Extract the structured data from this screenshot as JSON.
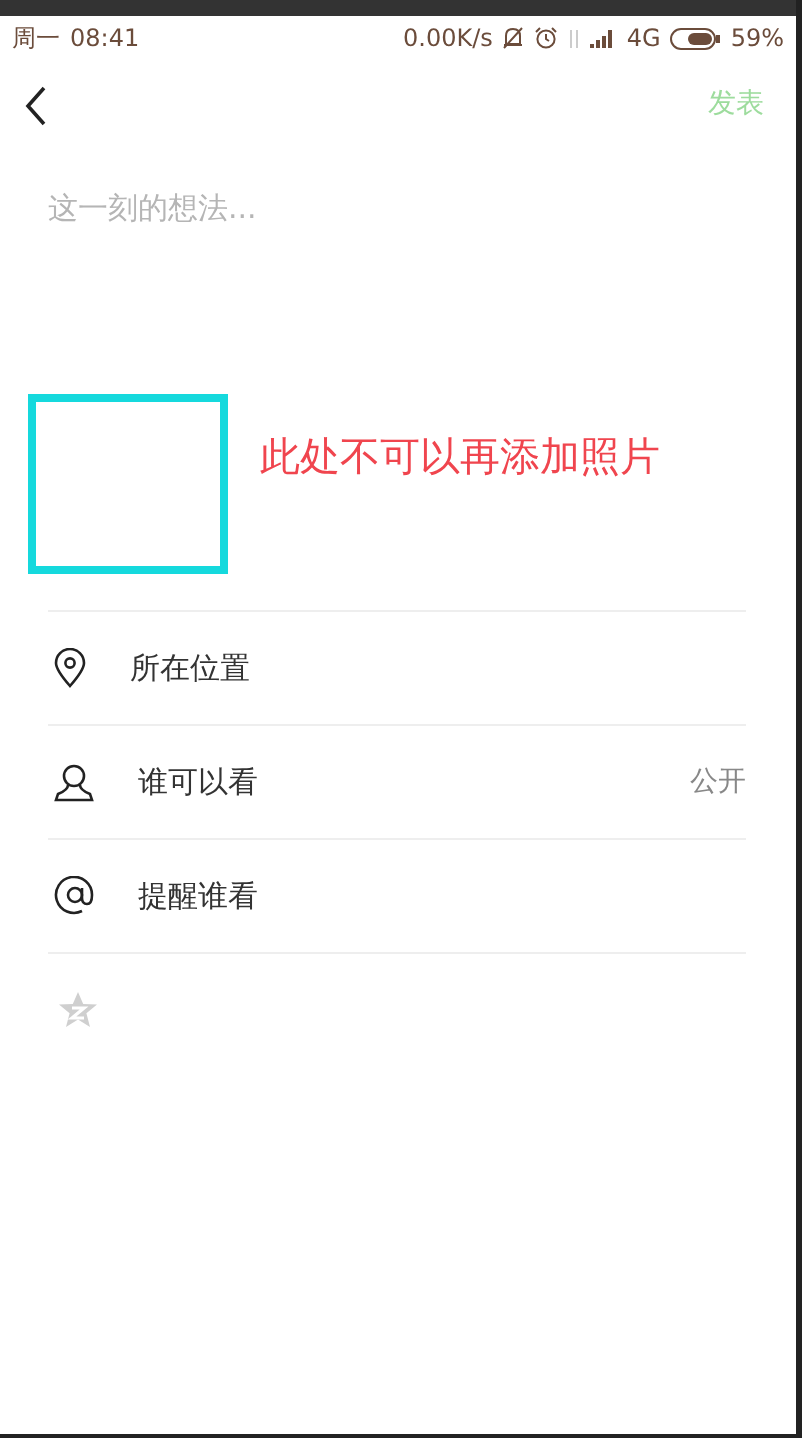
{
  "status_bar": {
    "day": "周一",
    "time": "08:41",
    "speed": "0.00K/s",
    "network": "4G",
    "battery": "59%"
  },
  "header": {
    "publish": "发表"
  },
  "composer": {
    "placeholder": "这一刻的想法..."
  },
  "annotation": "此处不可以再添加照片",
  "options": [
    {
      "kind": "location",
      "label": "所在位置"
    },
    {
      "kind": "visibility",
      "label": "谁可以看",
      "value": "公开"
    },
    {
      "kind": "mention",
      "label": "提醒谁看"
    }
  ]
}
